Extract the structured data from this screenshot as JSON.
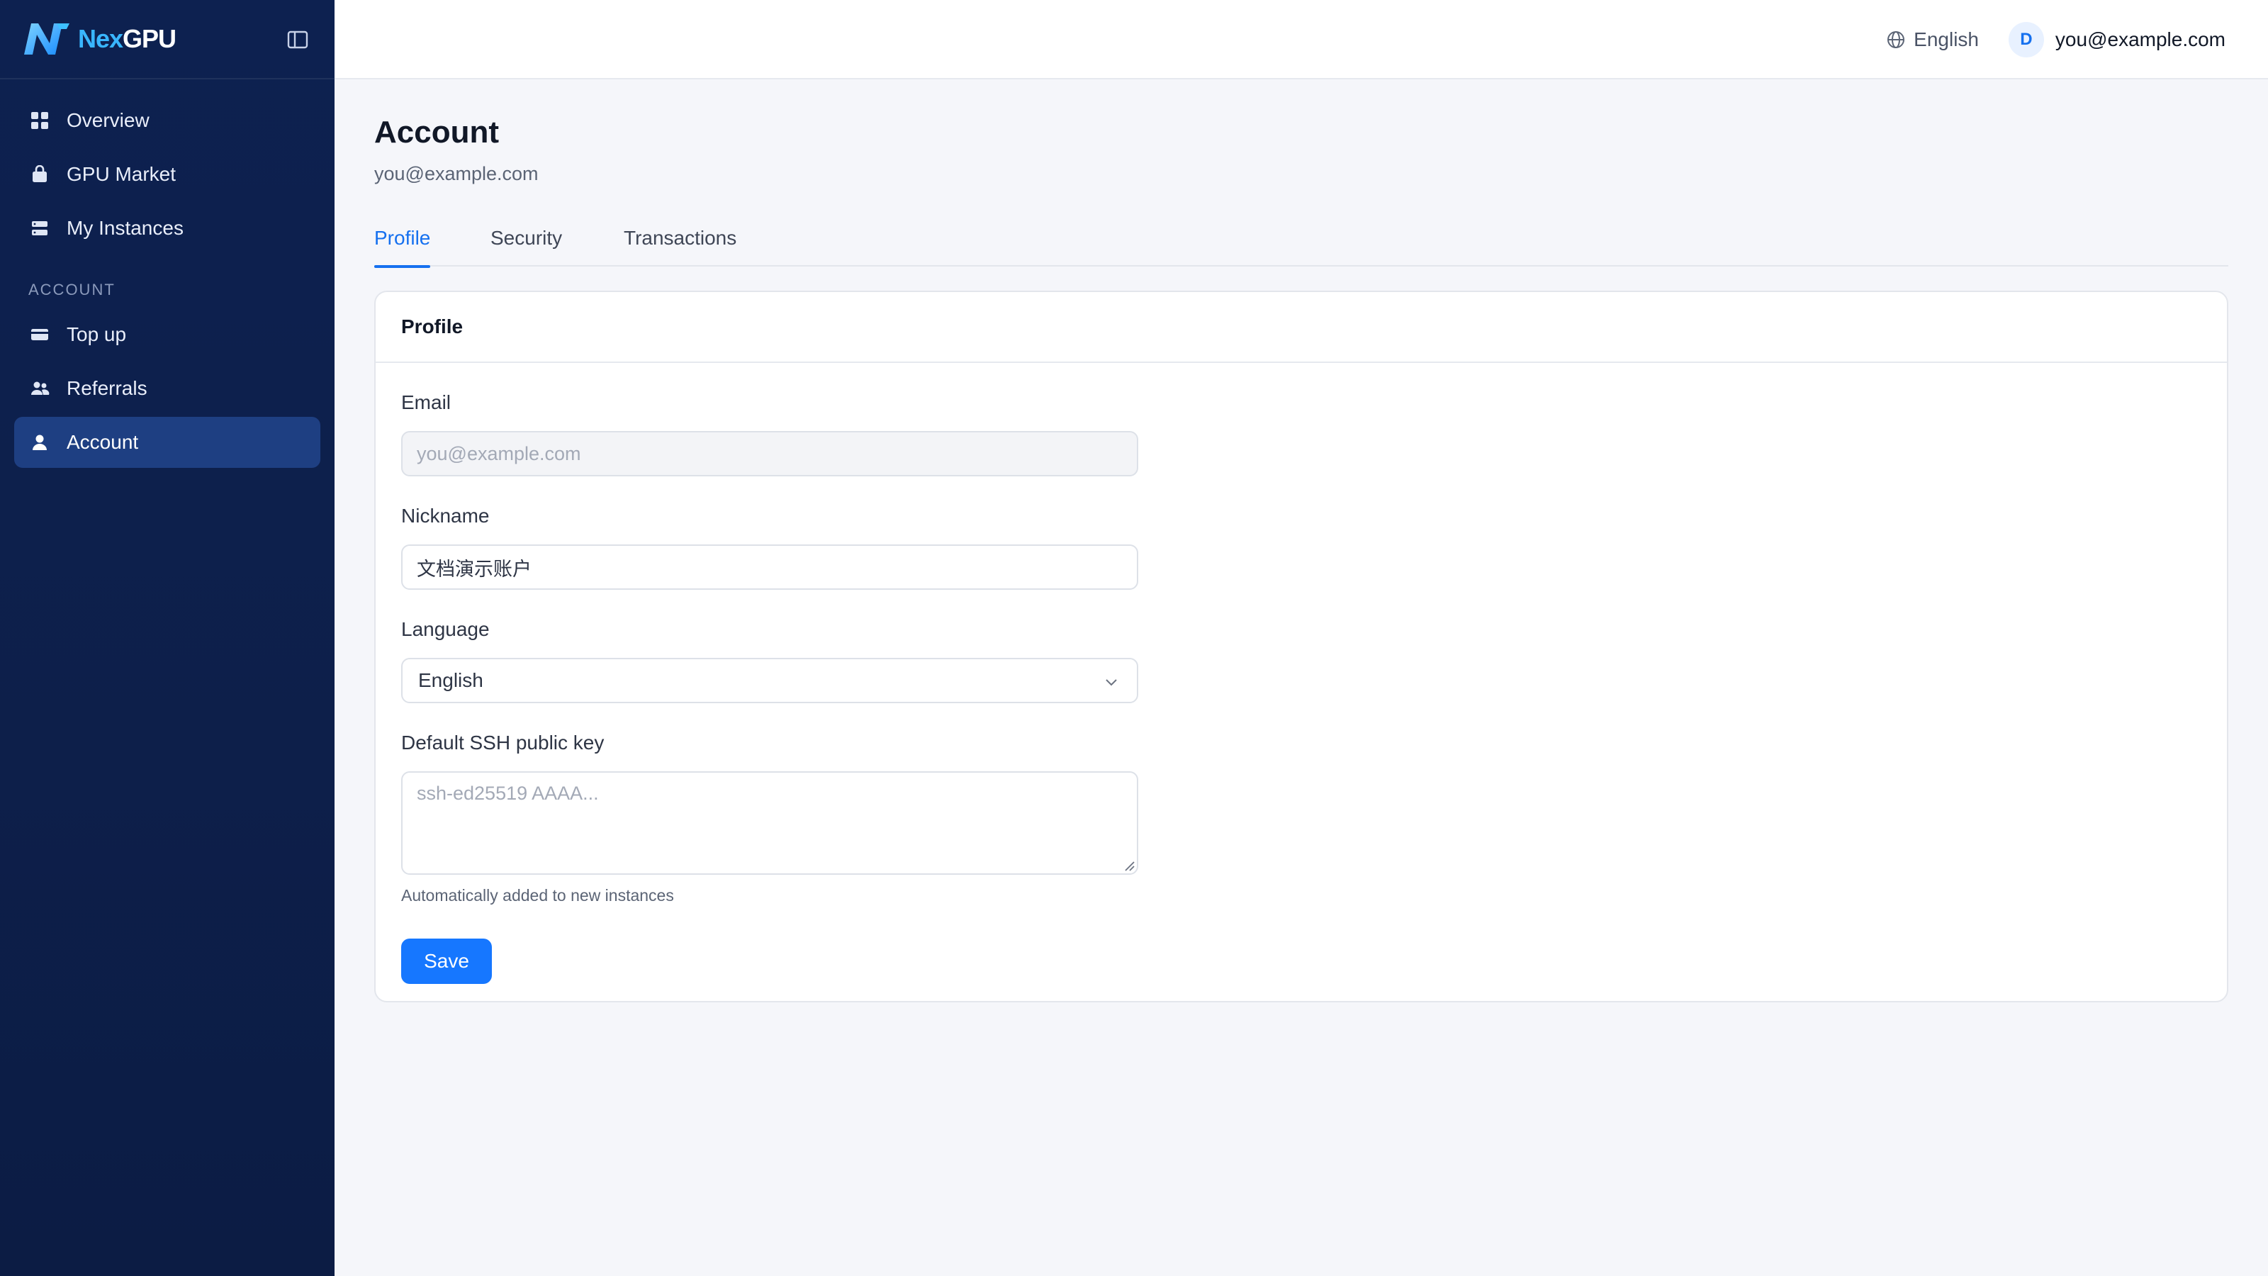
{
  "brand": {
    "name_part1": "Nex",
    "name_part2": "GPU"
  },
  "sidebar": {
    "items": [
      {
        "label": "Overview",
        "icon": "grid-icon"
      },
      {
        "label": "GPU Market",
        "icon": "bag-icon"
      },
      {
        "label": "My Instances",
        "icon": "server-icon"
      }
    ],
    "section_account": "ACCOUNT",
    "account_items": [
      {
        "label": "Top up",
        "icon": "card-icon"
      },
      {
        "label": "Referrals",
        "icon": "users-icon"
      },
      {
        "label": "Account",
        "icon": "user-icon",
        "active": true
      }
    ]
  },
  "topbar": {
    "language": "English",
    "avatar_initial": "D",
    "user_email": "you@example.com"
  },
  "page": {
    "title": "Account",
    "subtitle": "you@example.com"
  },
  "tabs": [
    {
      "label": "Profile",
      "active": true
    },
    {
      "label": "Security"
    },
    {
      "label": "Transactions"
    }
  ],
  "profile": {
    "card_title": "Profile",
    "email_label": "Email",
    "email_value": "you@example.com",
    "nickname_label": "Nickname",
    "nickname_value": "文档演示账户",
    "language_label": "Language",
    "language_value": "English",
    "ssh_label": "Default SSH public key",
    "ssh_placeholder": "ssh-ed25519 AAAA...",
    "ssh_hint": "Automatically added to new instances",
    "save_label": "Save"
  },
  "colors": {
    "sidebar_bg": "#0d2150",
    "active_item": "#1e3f82",
    "accent": "#1570ef",
    "button": "#1677ff"
  }
}
